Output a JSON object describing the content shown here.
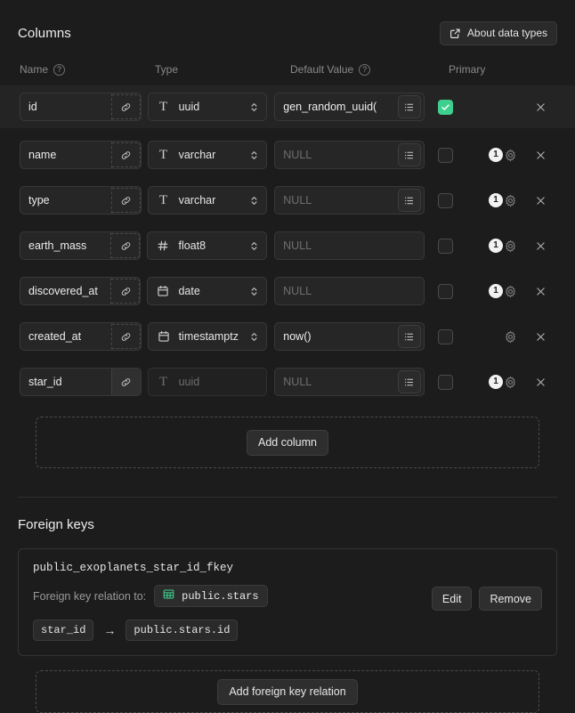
{
  "columns_section": {
    "title": "Columns",
    "about_button": {
      "label": "About data types",
      "icon": "external-link-icon"
    },
    "headers": {
      "name": "Name",
      "type": "Type",
      "default_value": "Default Value",
      "primary": "Primary",
      "help_icon": "?"
    },
    "rows": [
      {
        "name": "id",
        "type": "uuid",
        "type_icon": "text-type-icon",
        "default_value": "gen_random_uuid(",
        "default_placeholder": "NULL",
        "has_list_button": true,
        "primary": true,
        "highlighted": true,
        "link_active": false,
        "type_disabled": false,
        "badge": null,
        "show_gear": false
      },
      {
        "name": "name",
        "type": "varchar",
        "type_icon": "text-type-icon",
        "default_value": "",
        "default_placeholder": "NULL",
        "has_list_button": true,
        "primary": false,
        "highlighted": false,
        "link_active": false,
        "type_disabled": false,
        "badge": "1",
        "show_gear": true
      },
      {
        "name": "type",
        "type": "varchar",
        "type_icon": "text-type-icon",
        "default_value": "",
        "default_placeholder": "NULL",
        "has_list_button": true,
        "primary": false,
        "highlighted": false,
        "link_active": false,
        "type_disabled": false,
        "badge": "1",
        "show_gear": true
      },
      {
        "name": "earth_mass",
        "type": "float8",
        "type_icon": "number-type-icon",
        "default_value": "",
        "default_placeholder": "NULL",
        "has_list_button": false,
        "primary": false,
        "highlighted": false,
        "link_active": false,
        "type_disabled": false,
        "badge": "1",
        "show_gear": true
      },
      {
        "name": "discovered_at",
        "type": "date",
        "type_icon": "calendar-type-icon",
        "default_value": "",
        "default_placeholder": "NULL",
        "has_list_button": false,
        "primary": false,
        "highlighted": false,
        "link_active": false,
        "type_disabled": false,
        "badge": "1",
        "show_gear": true
      },
      {
        "name": "created_at",
        "type": "timestamptz",
        "type_icon": "calendar-type-icon",
        "default_value": "now()",
        "default_placeholder": "NULL",
        "has_list_button": true,
        "primary": false,
        "highlighted": false,
        "link_active": false,
        "type_disabled": false,
        "badge": null,
        "show_gear": true
      },
      {
        "name": "star_id",
        "type": "uuid",
        "type_icon": "text-type-icon",
        "default_value": "",
        "default_placeholder": "NULL",
        "has_list_button": true,
        "primary": false,
        "highlighted": false,
        "link_active": true,
        "type_disabled": true,
        "badge": "1",
        "show_gear": true
      }
    ],
    "add_column_label": "Add column"
  },
  "foreign_keys_section": {
    "title": "Foreign keys",
    "card": {
      "constraint_name": "public_exoplanets_star_id_fkey",
      "relation_label": "Foreign key relation to:",
      "target_table": "public.stars",
      "target_table_icon": "table-grid-icon",
      "source_column": "star_id",
      "arrow": "→",
      "target_column": "public.stars.id",
      "edit_label": "Edit",
      "remove_label": "Remove"
    },
    "add_fk_label": "Add foreign key relation"
  },
  "colors": {
    "background": "#1c1c1c",
    "accent_green": "#3ecf8e",
    "row_highlight": "#242424",
    "field_background": "#262626",
    "border": "#383838",
    "muted_text": "#8a8a8a"
  }
}
